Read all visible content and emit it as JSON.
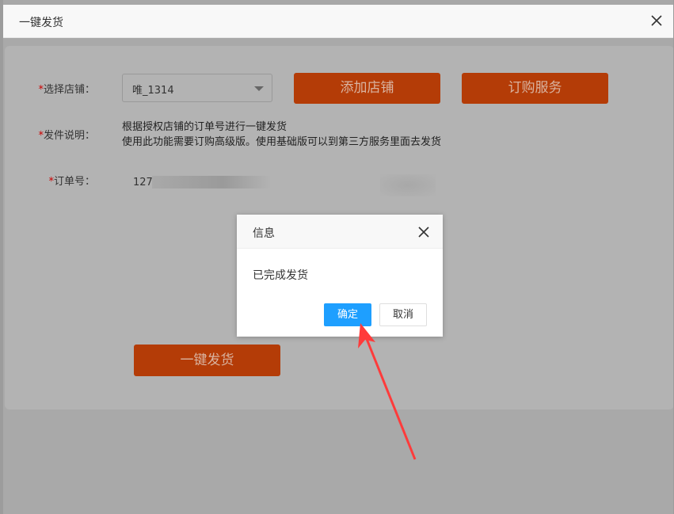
{
  "window": {
    "title": "一键发货"
  },
  "form": {
    "store_label": "选择店铺：",
    "store_value": "唯_1314",
    "add_store_button": "添加店铺",
    "subscribe_button": "订购服务",
    "desc_label": "发件说明：",
    "desc_line1": "根据授权店铺的订单号进行一键发货",
    "desc_line2": "使用此功能需要订购高级版。使用基础版可以到第三方服务里面去发货",
    "order_label": "订单号：",
    "order_value": "127",
    "ship_button": "一键发货"
  },
  "dialog": {
    "title": "信息",
    "message": "已完成发货",
    "ok_label": "确定",
    "cancel_label": "取消"
  },
  "colors": {
    "accent_orange": "#b43c07",
    "dialog_primary": "#1e9fff",
    "annotation_arrow": "#ff3b3b"
  }
}
